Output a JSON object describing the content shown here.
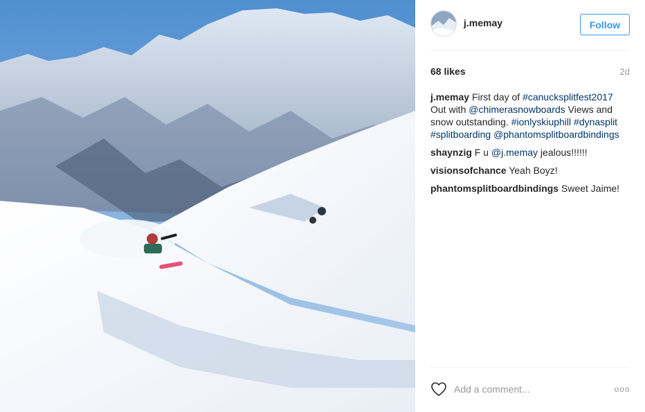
{
  "post": {
    "author": "j.memay",
    "follow_label": "Follow",
    "likes": "68 likes",
    "time": "2d",
    "photo_description_icon": "snowboard-photo"
  },
  "caption": {
    "user": "j.memay",
    "part1": "First day of ",
    "tag1": "#canucksplitfest2017",
    "part2": " Out with ",
    "tag2": "@chimerasnowboards",
    "part3": " Views and snow outstanding. ",
    "tag3": "#ionlyskiuphill",
    "tag4": "#dynasplit",
    "tag5": "#splitboarding",
    "tag6": "@phantomsplitboardbindings"
  },
  "comments": [
    {
      "user": "shaynzig",
      "pre": "F u ",
      "tag": "@j.memay",
      "post": " jealous!!!!!!"
    },
    {
      "user": "visionsofchance",
      "text": "Yeah Boyz!"
    },
    {
      "user": "phantomsplitboardbindings",
      "text": "Sweet Jaime!"
    }
  ],
  "footer": {
    "comment_placeholder": "Add a comment...",
    "more_label": "ooo"
  },
  "colors": {
    "link": "#003569",
    "follow": "#3897f0",
    "muted": "#999999"
  }
}
